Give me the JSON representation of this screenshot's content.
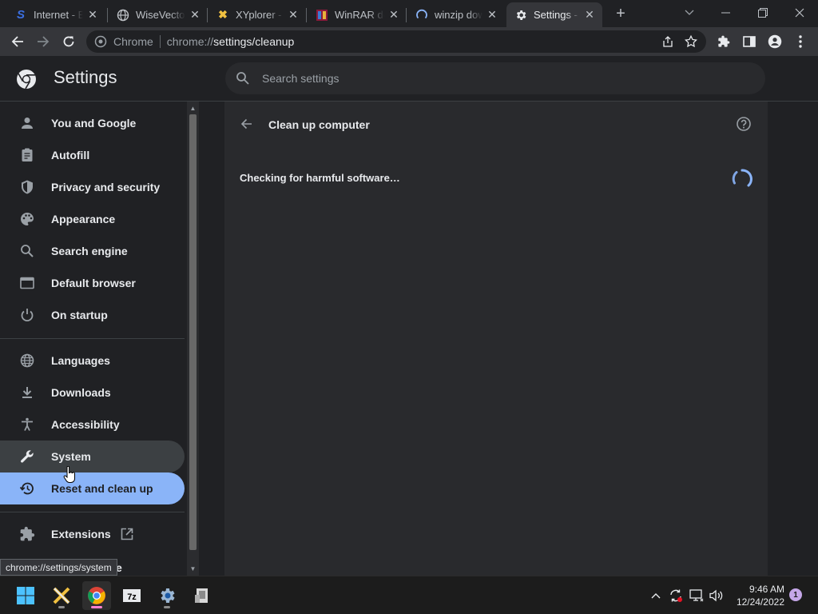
{
  "tabs": [
    {
      "title": "Internet - B",
      "icon": "s-logo-icon"
    },
    {
      "title": "WiseVector",
      "icon": "globe-icon"
    },
    {
      "title": "XYplorer - B",
      "icon": "xyplorer-icon"
    },
    {
      "title": "WinRAR do",
      "icon": "winrar-icon"
    },
    {
      "title": "winzip dow",
      "icon": "loading-icon"
    },
    {
      "title": "Settings - C",
      "icon": "gear-icon"
    }
  ],
  "omnibox": {
    "scheme_label": "Chrome",
    "url_host": "chrome://",
    "url_path": "settings/cleanup"
  },
  "settings": {
    "title": "Settings",
    "search_placeholder": "Search settings"
  },
  "sidebar": {
    "items": [
      {
        "label": "You and Google",
        "icon": "person-icon"
      },
      {
        "label": "Autofill",
        "icon": "clipboard-icon"
      },
      {
        "label": "Privacy and security",
        "icon": "shield-icon"
      },
      {
        "label": "Appearance",
        "icon": "palette-icon"
      },
      {
        "label": "Search engine",
        "icon": "search-icon"
      },
      {
        "label": "Default browser",
        "icon": "browser-icon"
      },
      {
        "label": "On startup",
        "icon": "power-icon"
      },
      {
        "label": "Languages",
        "icon": "globe-icon"
      },
      {
        "label": "Downloads",
        "icon": "download-icon"
      },
      {
        "label": "Accessibility",
        "icon": "accessibility-icon"
      },
      {
        "label": "System",
        "icon": "wrench-icon"
      },
      {
        "label": "Reset and clean up",
        "icon": "restore-icon"
      },
      {
        "label": "Extensions",
        "icon": "puzzle-icon"
      }
    ],
    "partial_label": "e"
  },
  "content": {
    "title": "Clean up computer",
    "status": "Checking for harmful software…"
  },
  "tooltip": "chrome://settings/system",
  "taskbar": {
    "time": "9:46 AM",
    "date": "12/24/2022",
    "notification_count": "1"
  },
  "colors": {
    "accent": "#8ab4f8",
    "background": "#202124",
    "card": "#292a2d"
  }
}
